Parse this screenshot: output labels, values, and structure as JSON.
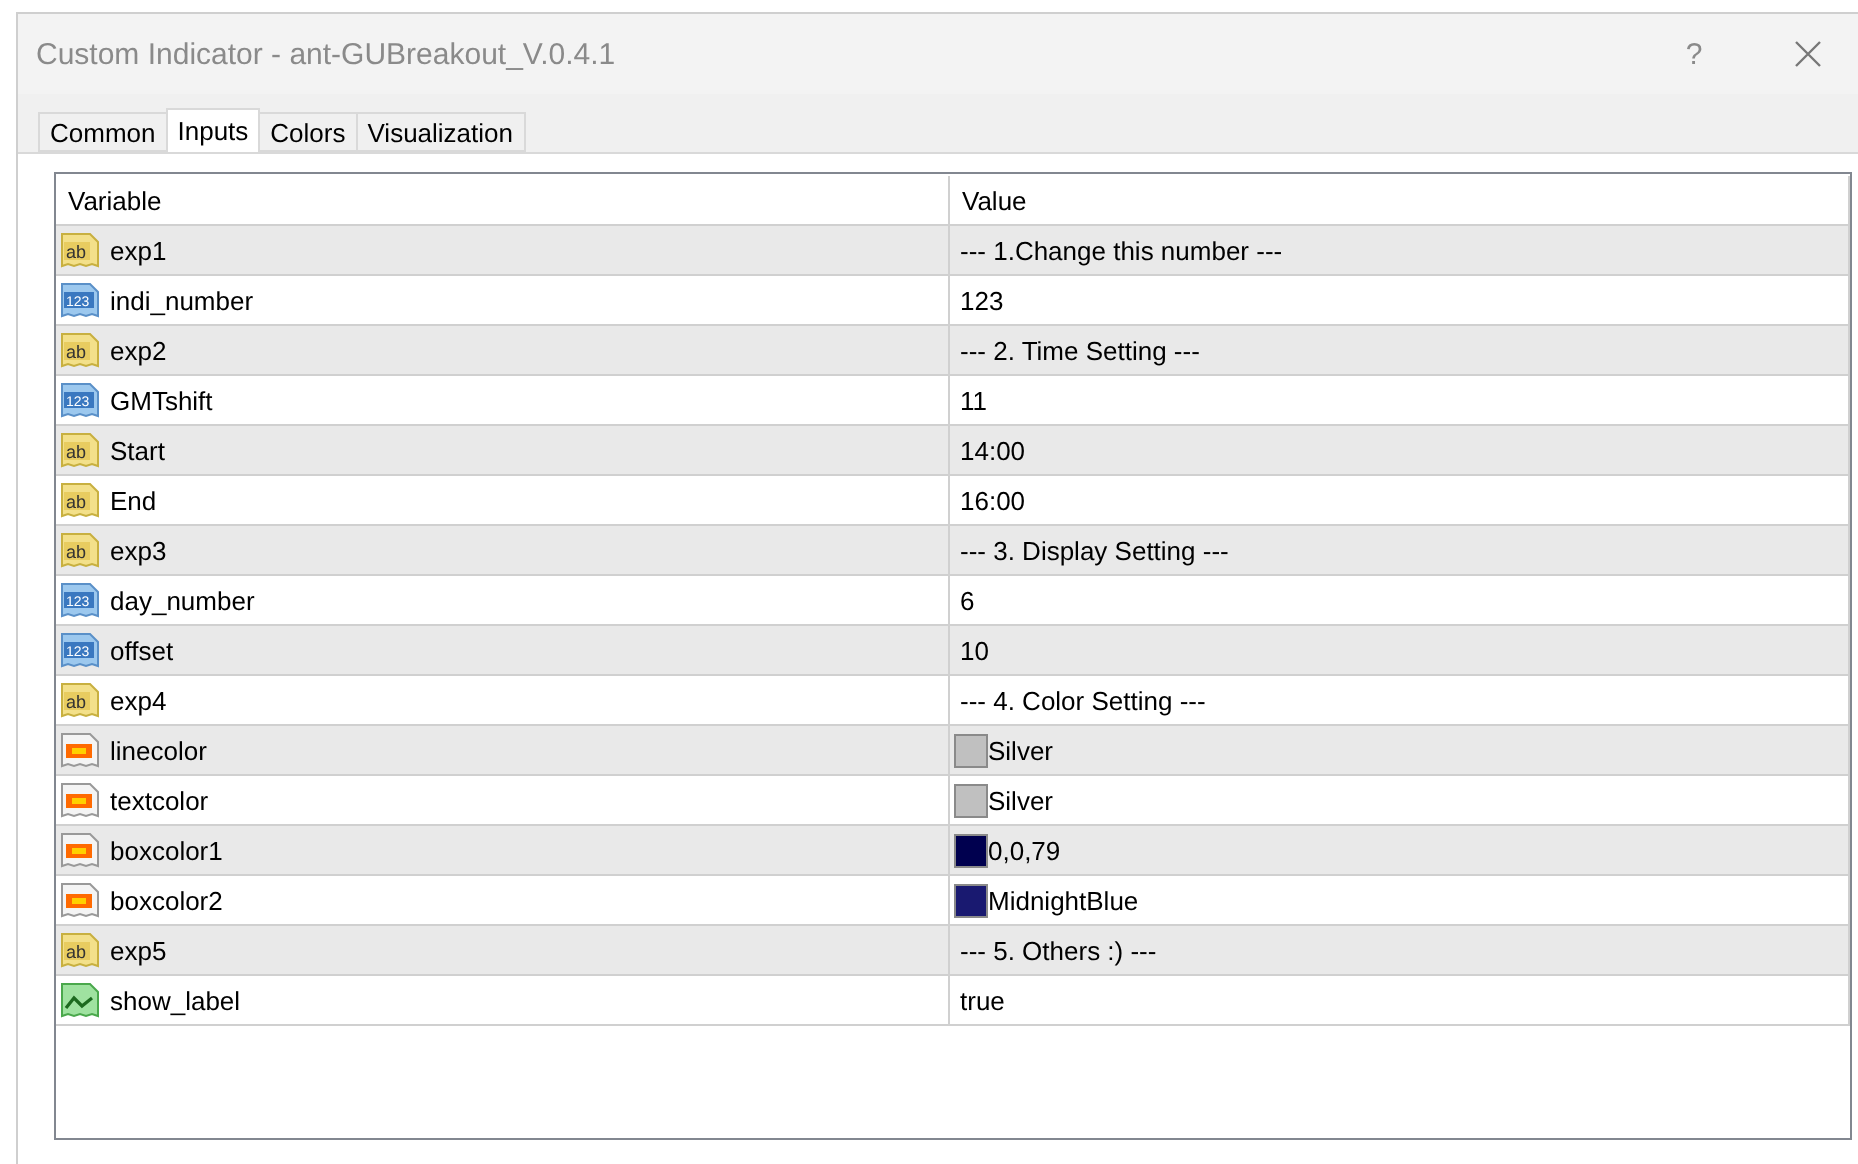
{
  "window": {
    "title": "Custom Indicator - ant-GUBreakout_V.0.4.1",
    "help": "?"
  },
  "tabs": [
    {
      "label": "Common",
      "selected": false
    },
    {
      "label": "Inputs",
      "selected": true
    },
    {
      "label": "Colors",
      "selected": false
    },
    {
      "label": "Visualization",
      "selected": false
    }
  ],
  "table": {
    "columns": [
      "Variable",
      "Value"
    ],
    "rows": [
      {
        "kind": "text",
        "badge": "ab",
        "variable": "exp1",
        "value": "--- 1.Change this number ---"
      },
      {
        "kind": "number",
        "badge": "123",
        "variable": "indi_number",
        "value": "123"
      },
      {
        "kind": "text",
        "badge": "ab",
        "variable": "exp2",
        "value": "--- 2. Time Setting ---"
      },
      {
        "kind": "number",
        "badge": "123",
        "variable": "GMTshift",
        "value": "11"
      },
      {
        "kind": "text",
        "badge": "ab",
        "variable": "Start",
        "value": "14:00"
      },
      {
        "kind": "text",
        "badge": "ab",
        "variable": "End",
        "value": "16:00"
      },
      {
        "kind": "text",
        "badge": "ab",
        "variable": "exp3",
        "value": "--- 3. Display Setting ---"
      },
      {
        "kind": "number",
        "badge": "123",
        "variable": "day_number",
        "value": "6"
      },
      {
        "kind": "number",
        "badge": "123",
        "variable": "offset",
        "value": "10"
      },
      {
        "kind": "text",
        "badge": "ab",
        "variable": "exp4",
        "value": "--- 4. Color Setting ---"
      },
      {
        "kind": "color",
        "variable": "linecolor",
        "value": "Silver",
        "color": "#c0c0c0"
      },
      {
        "kind": "color",
        "variable": "textcolor",
        "value": "Silver",
        "color": "#c0c0c0"
      },
      {
        "kind": "color",
        "variable": "boxcolor1",
        "value": "0,0,79",
        "color": "#00004f"
      },
      {
        "kind": "color",
        "variable": "boxcolor2",
        "value": "MidnightBlue",
        "color": "#191970"
      },
      {
        "kind": "text",
        "badge": "ab",
        "variable": "exp5",
        "value": "--- 5. Others :) ---"
      },
      {
        "kind": "bool",
        "variable": "show_label",
        "value": "true"
      }
    ]
  }
}
